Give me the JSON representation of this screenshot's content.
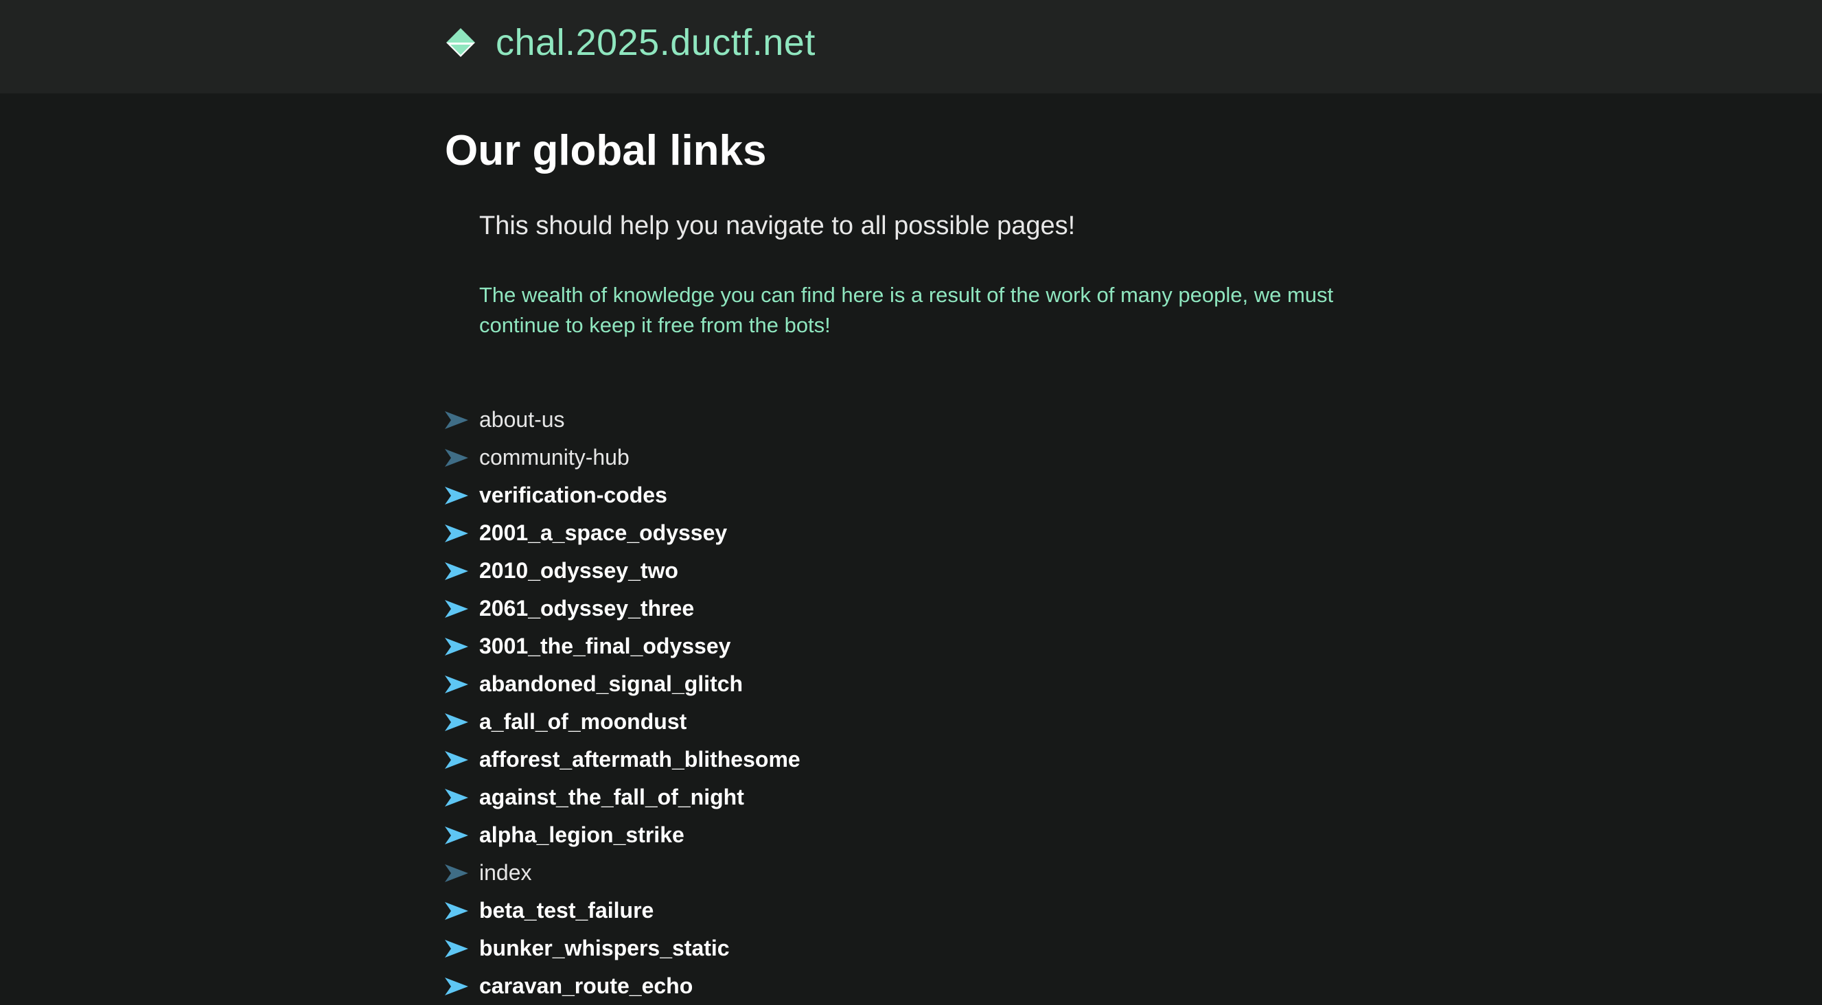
{
  "header": {
    "site_name": "chal.2025.ductf.net",
    "logo_icon": "diamond-logo-icon"
  },
  "main": {
    "title": "Our global links",
    "intro": "This should help you navigate to all possible pages!",
    "notice": "The wealth of knowledge you can find here is a result of the work of many people, we must continue to keep it free from the bots!"
  },
  "links": [
    {
      "label": "about-us",
      "style": "regular"
    },
    {
      "label": "community-hub",
      "style": "regular"
    },
    {
      "label": "verification-codes",
      "style": "bold"
    },
    {
      "label": "2001_a_space_odyssey",
      "style": "bold"
    },
    {
      "label": "2010_odyssey_two",
      "style": "bold"
    },
    {
      "label": "2061_odyssey_three",
      "style": "bold"
    },
    {
      "label": "3001_the_final_odyssey",
      "style": "bold"
    },
    {
      "label": "abandoned_signal_glitch",
      "style": "bold"
    },
    {
      "label": "a_fall_of_moondust",
      "style": "bold"
    },
    {
      "label": "afforest_aftermath_blithesome",
      "style": "bold"
    },
    {
      "label": "against_the_fall_of_night",
      "style": "bold"
    },
    {
      "label": "alpha_legion_strike",
      "style": "bold"
    },
    {
      "label": "index",
      "style": "regular"
    },
    {
      "label": "beta_test_failure",
      "style": "bold"
    },
    {
      "label": "bunker_whispers_static",
      "style": "bold"
    },
    {
      "label": "caravan_route_echo",
      "style": "bold"
    }
  ],
  "colors": {
    "header_bg": "#212322",
    "page_bg": "#171918",
    "accent_green": "#8fe6bf",
    "arrow_bright": "#5ec6f4",
    "arrow_dim": "#3f6d86"
  }
}
